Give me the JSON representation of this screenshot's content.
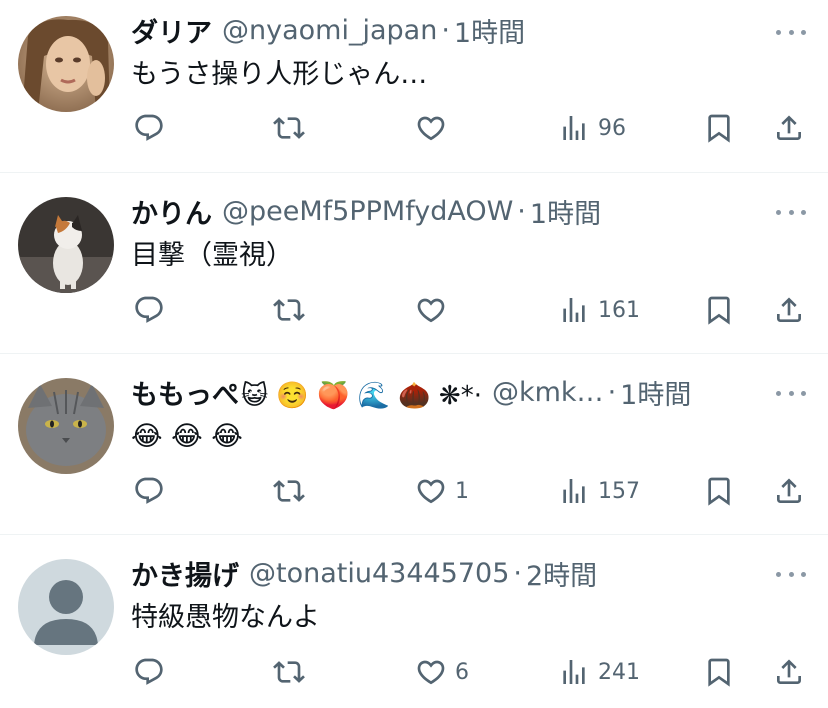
{
  "tweets": [
    {
      "name": "ダリア",
      "name_emoji": "",
      "handle": "@nyaomi_japan",
      "separator": "·",
      "time": "1時間",
      "text": "もうさ操り人形じゃん…",
      "actions": {
        "reply": "",
        "retweet": "",
        "like": "",
        "views": "96"
      },
      "avatar": "photo-woman"
    },
    {
      "name": "かりん",
      "name_emoji": "",
      "handle": "@peeMf5PPMfydAOW",
      "separator": "·",
      "time": "1時間",
      "text": "目撃（霊視）",
      "actions": {
        "reply": "",
        "retweet": "",
        "like": "",
        "views": "161"
      },
      "avatar": "photo-calico-cat"
    },
    {
      "name": "ももっぺ",
      "name_emoji": "😺 ☺️ 🍑 🌊 🌰 ❋*·",
      "handle": "@kmk…",
      "separator": "·",
      "time": "1時間",
      "text": "😂 😂 😂",
      "actions": {
        "reply": "",
        "retweet": "",
        "like": "1",
        "views": "157"
      },
      "avatar": "photo-gray-cat"
    },
    {
      "name": "かき揚げ",
      "name_emoji": "",
      "handle": "@tonatiu43445705",
      "separator": "·",
      "time": "2時間",
      "text": "特級愚物なんよ",
      "actions": {
        "reply": "",
        "retweet": "",
        "like": "6",
        "views": "241"
      },
      "avatar": "default-avatar"
    }
  ],
  "colors": {
    "text": "#0f1419",
    "secondary": "#536471",
    "divider": "#eff3f4",
    "default_avatar_bg": "#cfd9de",
    "default_avatar_fg": "#66757f"
  },
  "icons": [
    "reply-icon",
    "retweet-icon",
    "like-icon",
    "views-icon",
    "bookmark-icon",
    "share-icon",
    "more-icon"
  ]
}
